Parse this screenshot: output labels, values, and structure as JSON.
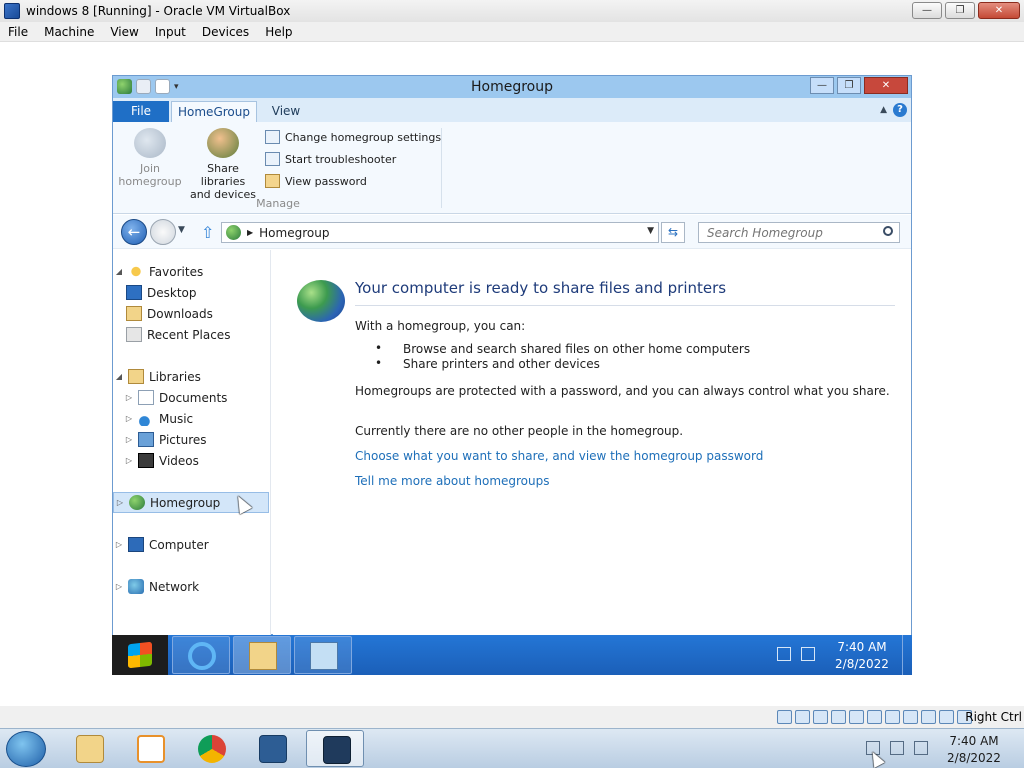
{
  "host_window": {
    "title": "windows 8 [Running] - Oracle VM VirtualBox",
    "buttons": [
      "—",
      "❐",
      "✕"
    ],
    "menu": [
      "File",
      "Machine",
      "View",
      "Input",
      "Devices",
      "Help"
    ]
  },
  "explorer": {
    "title": "Homegroup",
    "window_buttons": [
      "—",
      "❐",
      "✕"
    ],
    "ribbon": {
      "tabs": [
        "File",
        "HomeGroup",
        "View"
      ],
      "active_tab": "HomeGroup",
      "join_label_1": "Join",
      "join_label_2": "homegroup",
      "share_label_1": "Share libraries",
      "share_label_2": "and devices",
      "actions": [
        "Change homegroup settings",
        "Start troubleshooter",
        "View password"
      ],
      "group_label": "Manage"
    },
    "address": {
      "location": "Homegroup",
      "search_placeholder": "Search Homegroup"
    },
    "nav_pane": {
      "favorites": "Favorites",
      "favorites_items": [
        "Desktop",
        "Downloads",
        "Recent Places"
      ],
      "libraries": "Libraries",
      "libraries_items": [
        "Documents",
        "Music",
        "Pictures",
        "Videos"
      ],
      "homegroup": "Homegroup",
      "computer": "Computer",
      "network": "Network"
    },
    "content": {
      "heading": "Your computer is ready to share files and printers",
      "intro": "With a homegroup, you can:",
      "bullets": [
        "Browse and search shared files on other home computers",
        "Share printers and other devices"
      ],
      "protected": "Homegroups are protected with a password, and you can always control what you share.",
      "no_people": "Currently there are no other people in the homegroup.",
      "link_share": "Choose what you want to share, and view the homegroup password",
      "link_more": "Tell me more about homegroups"
    }
  },
  "guest_taskbar": {
    "time": "7:40 AM",
    "date": "2/8/2022"
  },
  "vb_status": {
    "host_key": "Right Ctrl"
  },
  "host_taskbar": {
    "time": "7:40 AM",
    "date": "2/8/2022"
  },
  "colors": {
    "link": "#1e6fb9",
    "heading": "#1e3b7a",
    "file_tab": "#1f6fc6",
    "guest_taskbar": "#1b5fb8"
  }
}
